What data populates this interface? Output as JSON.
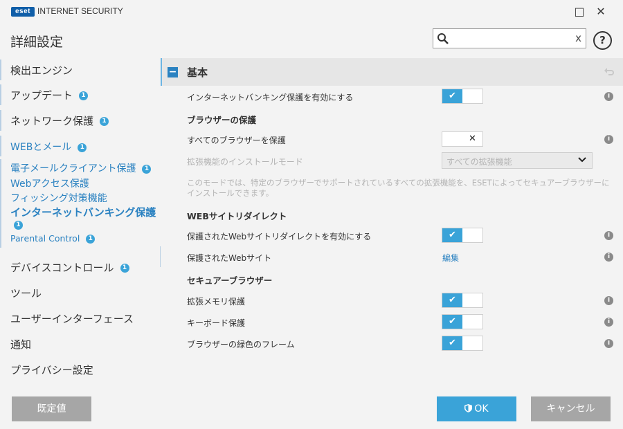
{
  "window": {
    "logo": "eset",
    "product": "INTERNET SECURITY",
    "maximize_icon": "□",
    "close_icon": "✕"
  },
  "header": {
    "title": "詳細設定",
    "search": {
      "value": "",
      "placeholder": "",
      "clear": "x"
    },
    "help": "?"
  },
  "sidebar": {
    "items": [
      {
        "label": "検出エンジン",
        "badge": ""
      },
      {
        "label": "アップデート",
        "badge": "1"
      },
      {
        "label": "ネットワーク保護",
        "badge": "1"
      },
      {
        "label": "WEBとメール",
        "badge": "1"
      },
      {
        "label": "電子メールクライアント保護",
        "badge": "1"
      },
      {
        "label": "Webアクセス保護",
        "badge": ""
      },
      {
        "label": "フィッシング対策機能",
        "badge": ""
      },
      {
        "label": "インターネットバンキング保護",
        "badge": "1"
      },
      {
        "label": "Parental Control",
        "badge": "1"
      },
      {
        "label": "デバイスコントロール",
        "badge": "1"
      },
      {
        "label": "ツール",
        "badge": ""
      },
      {
        "label": "ユーザーインターフェース",
        "badge": ""
      },
      {
        "label": "通知",
        "badge": ""
      },
      {
        "label": "プライバシー設定",
        "badge": ""
      }
    ]
  },
  "main": {
    "section_title": "基本",
    "collapse_icon": "−",
    "rows": {
      "enable_banking": {
        "label": "インターネットバンキング保護を有効にする",
        "state": "on"
      },
      "browser_protection_heading": "ブラウザーの保護",
      "protect_all_browsers": {
        "label": "すべてのブラウザーを保護",
        "state": "off"
      },
      "extension_install_mode": {
        "label": "拡張機能のインストールモード",
        "selected": "すべての拡張機能"
      },
      "note": "このモードでは、特定のブラウザーでサポートされているすべての拡張機能を、ESETによってセキュアーブラウザーにインストールできます。",
      "web_redirect_heading": "WEBサイトリダイレクト",
      "enable_redirect": {
        "label": "保護されたWebサイトリダイレクトを有効にする",
        "state": "on"
      },
      "protected_sites": {
        "label": "保護されたWebサイト",
        "link": "編集"
      },
      "secure_browser_heading": "セキュアーブラウザー",
      "memory_protection": {
        "label": "拡張メモリ保護",
        "state": "on"
      },
      "keyboard_protection": {
        "label": "キーボード保護",
        "state": "on"
      },
      "green_frame": {
        "label": "ブラウザーの緑色のフレーム",
        "state": "on"
      }
    },
    "toggle_on_mark": "✔",
    "toggle_off_mark": "✕",
    "info_mark": "i"
  },
  "footer": {
    "default_button": "既定値",
    "ok_button": "OK",
    "cancel_button": "キャンセル"
  },
  "colors": {
    "accent": "#3aa3d8",
    "link": "#2b82c1",
    "button_gray": "#a6a6a6"
  }
}
